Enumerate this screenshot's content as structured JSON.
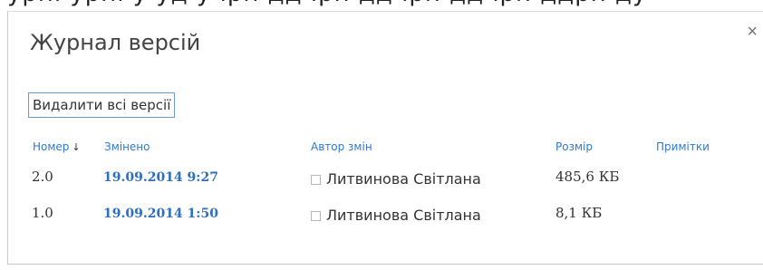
{
  "dialog": {
    "title": "Журнал версій",
    "close_glyph": "×",
    "close_icon": "close-icon",
    "delete_all_label": "Видалити всі версії"
  },
  "table": {
    "columns": {
      "number": "Номер",
      "sort_indicator": "↓",
      "modified": "Змінено",
      "author": "Автор змін",
      "size": "Розмір",
      "notes": "Примітки"
    },
    "rows": [
      {
        "number": "2.0",
        "modified": "19.09.2014 9:27",
        "author": "Литвинова Світлана",
        "size": "485,6 КБ",
        "notes": ""
      },
      {
        "number": "1.0",
        "modified": "19.09.2014 1:50",
        "author": "Литвинова Світлана",
        "size": "8,1 КБ",
        "notes": ""
      }
    ]
  },
  "colors": {
    "link": "#2b6fc2",
    "header": "#2d7ad1",
    "button_border": "#6b9bd2"
  }
}
